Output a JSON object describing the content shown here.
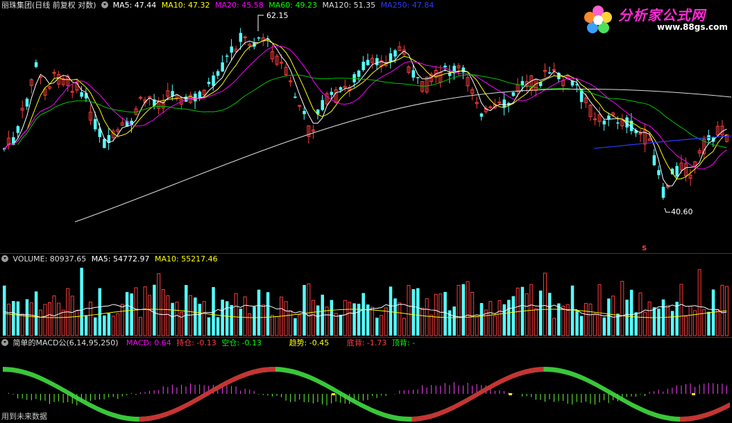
{
  "price_panel": {
    "stock_name": "丽珠集团(日线 前复权 对数)",
    "indicators": [
      {
        "label": "MA5: 47.44",
        "color": "#ffffff"
      },
      {
        "label": "MA10: 47.32",
        "color": "#ffff00"
      },
      {
        "label": "MA20: 45.58",
        "color": "#ff00ff"
      },
      {
        "label": "MA60: 49.23",
        "color": "#00ff00"
      },
      {
        "label": "MA120: 51.35",
        "color": "#dddddd"
      },
      {
        "label": "MA250: 47.84",
        "color": "#2a3bff"
      }
    ],
    "high_label": "62.15",
    "low_label": "40.60",
    "marker": "S"
  },
  "volume_panel": {
    "title": "VOLUME: 80937.65",
    "ma5": "MA5: 54772.97",
    "ma10": "MA10: 55217.46"
  },
  "macd_panel": {
    "name": "简单的MACD公(6,14,95,250)",
    "items": [
      {
        "label": "MACD: 0.64",
        "color": "#ff00ff"
      },
      {
        "label": "持仓: -0.13",
        "color": "#ff4040"
      },
      {
        "label": "空仓: -0.13",
        "color": "#00ff00"
      },
      {
        "label": "趋势: -0.45",
        "color": "#ffff00"
      },
      {
        "label": "底背: -1.73",
        "color": "#ff4040"
      },
      {
        "label": "顶背: -",
        "color": "#00ff00"
      }
    ]
  },
  "footer_note": "用到未来数据",
  "logo": {
    "brand": "分析家公式网",
    "url": "www.88gs.com"
  },
  "colors": {
    "up_candle": "#ff3c3c",
    "down_candle": "#54ffff",
    "divider": "#8a1a1a"
  }
}
